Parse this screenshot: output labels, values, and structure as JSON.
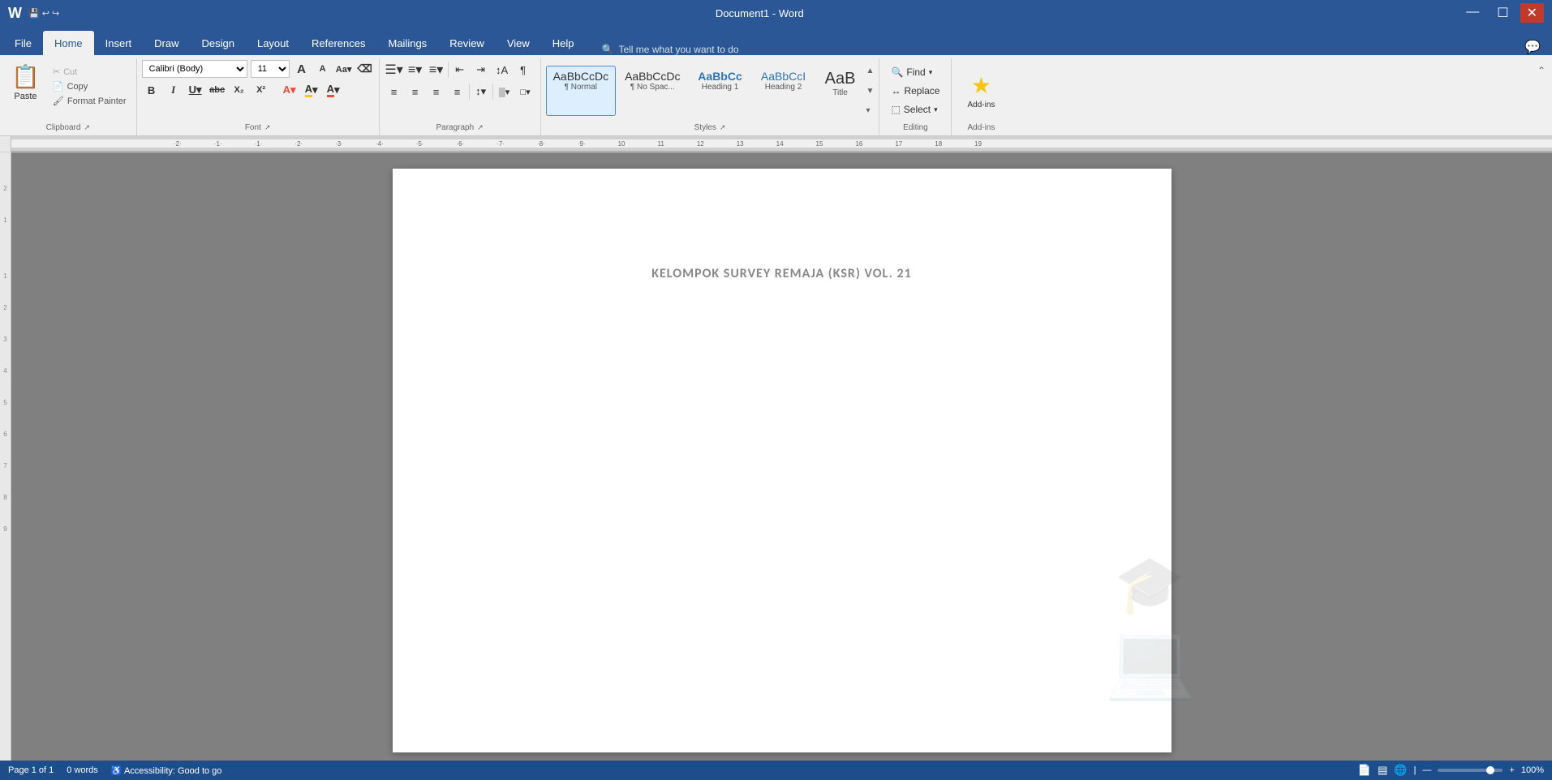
{
  "app": {
    "title": "Document1 - Word",
    "window_controls": [
      "—",
      "☐",
      "✕"
    ]
  },
  "tabs": {
    "items": [
      "File",
      "Home",
      "Insert",
      "Draw",
      "Design",
      "Layout",
      "References",
      "Mailings",
      "Review",
      "View",
      "Help"
    ],
    "active": "Home",
    "search_placeholder": "Tell me what you want to do"
  },
  "ribbon": {
    "clipboard": {
      "label": "Clipboard",
      "paste_label": "Paste",
      "paste_icon": "📋",
      "cut_label": "Cut",
      "cut_icon": "✂",
      "copy_label": "Copy",
      "copy_icon": "📄",
      "format_painter_label": "Format Painter",
      "format_painter_icon": "🖌"
    },
    "font": {
      "label": "Font",
      "font_name": "Calibri (Body)",
      "font_size": "11",
      "grow_icon": "A",
      "shrink_icon": "A",
      "case_icon": "Aa",
      "clear_icon": "⌫",
      "bold": "B",
      "italic": "I",
      "underline": "U",
      "strikethrough": "abc",
      "subscript": "X₂",
      "superscript": "X²",
      "text_color_label": "A",
      "highlight_label": "A"
    },
    "paragraph": {
      "label": "Paragraph",
      "bullets_icon": "≡",
      "numbering_icon": "≡",
      "multilevel_icon": "≡",
      "decrease_indent_icon": "←",
      "increase_indent_icon": "→",
      "sort_icon": "↕",
      "show_hide_icon": "¶",
      "align_left": "≡",
      "align_center": "≡",
      "align_right": "≡",
      "justify": "≡",
      "line_spacing": "↕",
      "shading": "▒",
      "borders": "□"
    },
    "styles": {
      "label": "Styles",
      "items": [
        {
          "label": "¶ Normal",
          "preview_class": "normal",
          "active": true
        },
        {
          "label": "¶ No Spac...",
          "preview_class": "nospace",
          "active": false
        },
        {
          "label": "Heading 1",
          "preview_class": "heading1",
          "active": false
        },
        {
          "label": "Heading 2",
          "preview_class": "heading2",
          "active": false
        },
        {
          "label": "Title",
          "preview_class": "title",
          "active": false
        }
      ]
    },
    "editing": {
      "label": "Editing",
      "find_label": "Find",
      "replace_label": "Replace",
      "select_label": "Select"
    },
    "addins": {
      "label": "Add-ins",
      "icon": "★"
    }
  },
  "document": {
    "content": "KELOMPOK SURVEY REMAJA (KSR) VOL. 21"
  },
  "status_bar": {
    "page": "Page 1 of 1",
    "words": "0 words",
    "accessibility": "Accessibility: Good to go",
    "zoom": "100%",
    "view_icons": [
      "▤",
      "▦",
      "📄"
    ]
  }
}
